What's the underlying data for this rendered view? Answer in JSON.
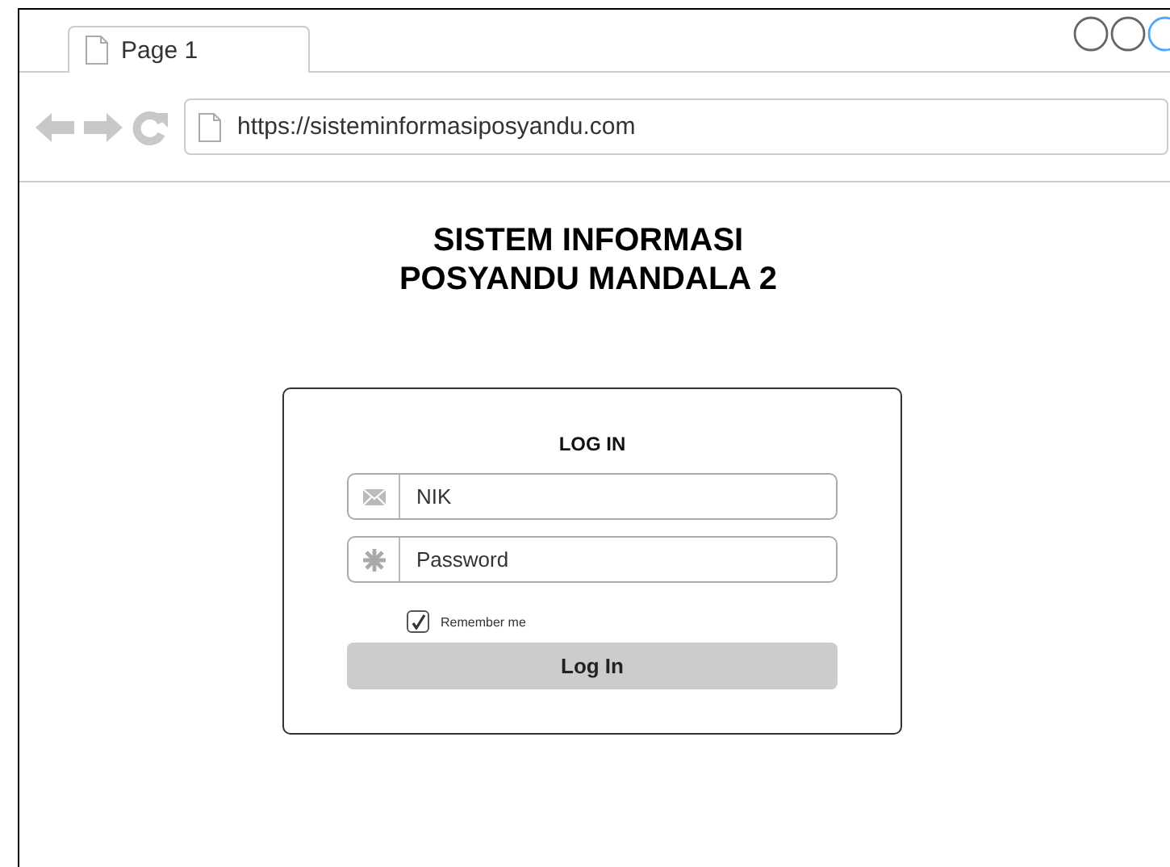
{
  "browser": {
    "tab": {
      "label": "Page 1"
    },
    "window_controls": [
      {
        "color": "#666666"
      },
      {
        "color": "#666666"
      },
      {
        "color": "#4da6ff"
      }
    ],
    "address": "https://sisteminformasiposyandu.com"
  },
  "page": {
    "title_lines": [
      "SISTEM INFORMASI",
      "POSYANDU MANDALA 2"
    ],
    "login": {
      "title": "LOG IN",
      "fields": [
        {
          "kind": "email",
          "placeholder": "NIK"
        },
        {
          "kind": "password",
          "placeholder": "Password"
        }
      ],
      "remember": {
        "label": "Remember me",
        "checked": true
      },
      "button": "Log In"
    }
  }
}
